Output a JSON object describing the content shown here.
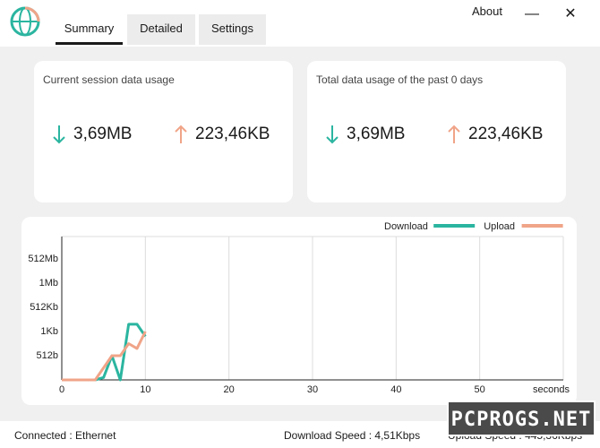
{
  "tabs": [
    {
      "label": "Summary",
      "active": true
    },
    {
      "label": "Detailed",
      "active": false
    },
    {
      "label": "Settings",
      "active": false
    }
  ],
  "window": {
    "about_label": "About",
    "minimize_glyph": "—",
    "close_glyph": "✕"
  },
  "session_card": {
    "title": "Current session data usage",
    "download": "3,69MB",
    "upload": "223,46KB"
  },
  "total_card": {
    "title": "Total data usage of the past 0 days",
    "download": "3,69MB",
    "upload": "223,46KB"
  },
  "colors": {
    "download": "#2bb5a0",
    "upload": "#f0a488"
  },
  "icons": {
    "download": "arrow-down-icon",
    "upload": "arrow-up-icon",
    "logo": "globe-icon"
  },
  "chart_data": {
    "type": "line",
    "legend": [
      "Download",
      "Upload"
    ],
    "legend_position": "top-right",
    "xlabel": "seconds",
    "x_ticks": [
      "0",
      "10",
      "20",
      "30",
      "40",
      "50"
    ],
    "xlim": [
      0,
      60
    ],
    "y_ticks": [
      "512b",
      "1Kb",
      "512Kb",
      "1Mb",
      "512Mb"
    ],
    "grid": true,
    "series": [
      {
        "name": "Download",
        "x": [
          0,
          4,
          5,
          6,
          7,
          8,
          9,
          10
        ],
        "y": [
          0,
          0,
          0.1,
          1.0,
          0,
          2.3,
          2.3,
          1.8
        ]
      },
      {
        "name": "Upload",
        "x": [
          0,
          4,
          5,
          6,
          7,
          8,
          9,
          10
        ],
        "y": [
          0,
          0,
          0.5,
          1.0,
          1.0,
          1.5,
          1.3,
          2.0
        ]
      }
    ]
  },
  "status": {
    "connection": "Connected : Ethernet",
    "download_speed": "Download Speed : 4,51Kbps",
    "upload_speed": "Upload Speed : 445,36Kbps"
  },
  "watermark": "PCPROGS.NET"
}
